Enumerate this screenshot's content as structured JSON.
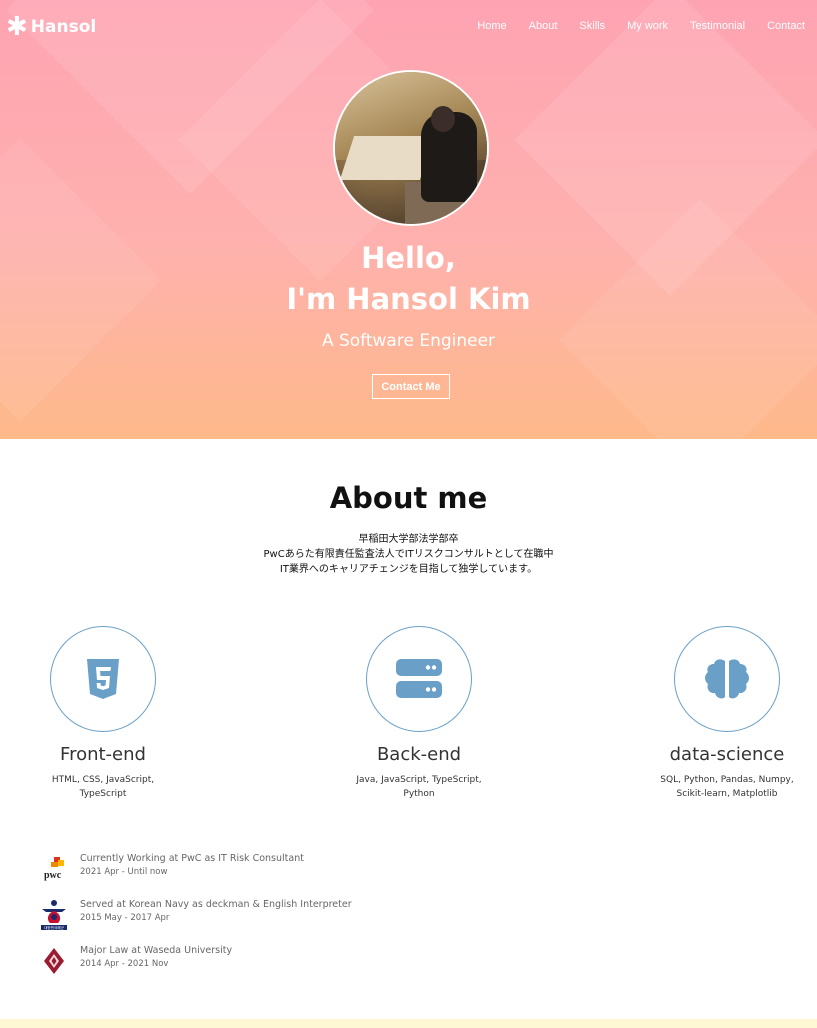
{
  "brand": {
    "name": "Hansol",
    "star": "✱"
  },
  "nav": [
    "Home",
    "About",
    "Skills",
    "My work",
    "Testimonial",
    "Contact"
  ],
  "hero": {
    "greeting_line1": "Hello,",
    "greeting_line2": "I'm Hansol Kim",
    "subtitle": "A Software Engineer",
    "cta_label": "Contact Me"
  },
  "about": {
    "title": "About me",
    "lines": [
      "早稲田大学部法学部卒",
      "PwCあらた有限責任監査法人でITリスクコンサルトとして在職中",
      "IT業界へのキャリアチェンジを目指して独学しています。"
    ]
  },
  "skills": [
    {
      "title": "Front-end",
      "desc": "HTML, CSS, JavaScript, TypeScript",
      "icon": "html5-icon"
    },
    {
      "title": "Back-end",
      "desc": "Java, JavaScript, TypeScript, Python",
      "icon": "server-icon"
    },
    {
      "title": "data-science",
      "desc": "SQL, Python, Pandas, Numpy, Scikit-learn, Matplotlib",
      "icon": "brain-icon"
    }
  ],
  "experience": [
    {
      "role": "Currently Working at PwC as IT Risk Consultant",
      "date": "2021 Apr - Until now",
      "logo": "pwc-logo",
      "logo_text": "pwc"
    },
    {
      "role": "Served at Korean Navy as deckman & English Interpreter",
      "date": "2015 May - 2017 Apr",
      "logo": "korean-navy-logo",
      "logo_text": "대한민국해군"
    },
    {
      "role": "Major Law at Waseda University",
      "date": "2014 Apr - 2021 Nov",
      "logo": "waseda-logo"
    }
  ],
  "colors": {
    "accent": "#6aa0c8",
    "hero_top": "#fea3b2",
    "hero_bottom": "#feb98a"
  }
}
